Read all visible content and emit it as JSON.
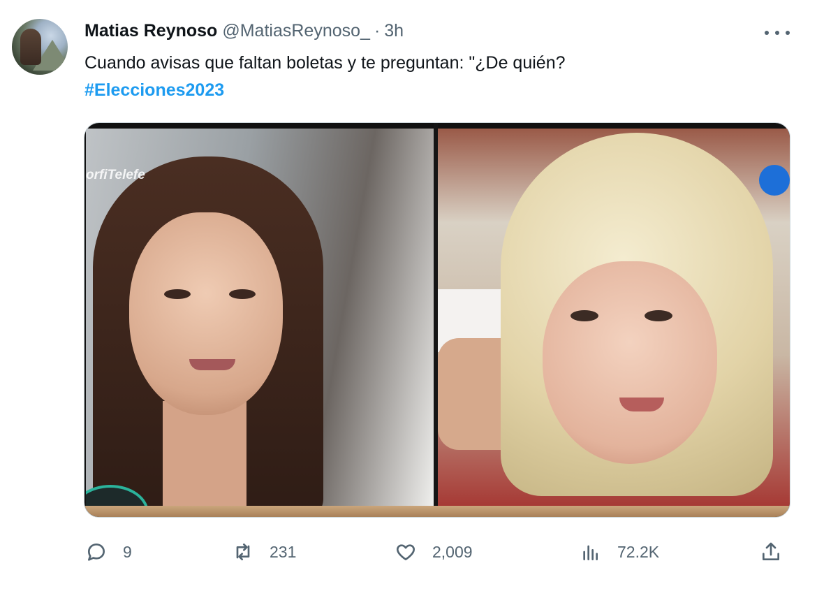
{
  "tweet": {
    "author": {
      "name": "Matias Reynoso",
      "handle": "@MatiasReynoso_",
      "separator": "·",
      "time": "3h"
    },
    "text": "Cuando avisas que faltan boletas y te preguntan: \"¿De quién?",
    "hashtag": "#Elecciones2023",
    "media": {
      "left_overlay_text": "orfiTelefe"
    },
    "actions": {
      "replies": "9",
      "retweets": "231",
      "likes": "2,009",
      "views": "72.2K"
    }
  },
  "colors": {
    "link": "#1d9bf0",
    "secondary_text": "#536471",
    "primary_text": "#0f1419"
  },
  "icons": [
    "more-icon",
    "reply-icon",
    "retweet-icon",
    "like-icon",
    "views-icon",
    "share-icon"
  ]
}
